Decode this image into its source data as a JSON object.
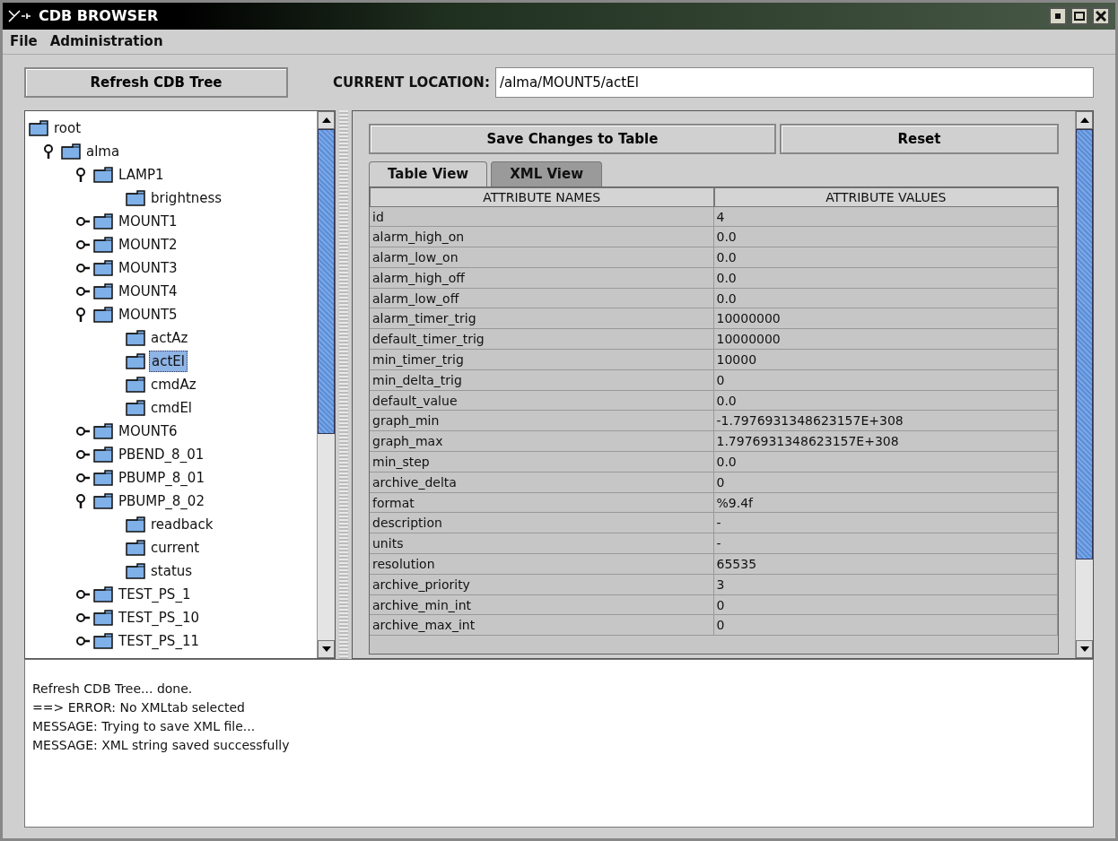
{
  "window": {
    "title": "CDB BROWSER"
  },
  "menu": [
    "File",
    "Administration"
  ],
  "refresh_button": "Refresh CDB Tree",
  "location": {
    "label": "CURRENT LOCATION:",
    "value": "/alma/MOUNT5/actEl"
  },
  "tree": [
    {
      "label": "root",
      "selected": false,
      "children": [
        {
          "label": "alma",
          "selected": false,
          "expanded": true,
          "children": [
            {
              "label": "LAMP1",
              "selected": false,
              "expanded": true,
              "children": [
                {
                  "label": "brightness",
                  "selected": false
                }
              ]
            },
            {
              "label": "MOUNT1",
              "selected": false,
              "expanded": false
            },
            {
              "label": "MOUNT2",
              "selected": false,
              "expanded": false
            },
            {
              "label": "MOUNT3",
              "selected": false,
              "expanded": false
            },
            {
              "label": "MOUNT4",
              "selected": false,
              "expanded": false
            },
            {
              "label": "MOUNT5",
              "selected": false,
              "expanded": true,
              "children": [
                {
                  "label": "actAz",
                  "selected": false
                },
                {
                  "label": "actEl",
                  "selected": true
                },
                {
                  "label": "cmdAz",
                  "selected": false
                },
                {
                  "label": "cmdEl",
                  "selected": false
                }
              ]
            },
            {
              "label": "MOUNT6",
              "selected": false,
              "expanded": false
            },
            {
              "label": "PBEND_8_01",
              "selected": false,
              "expanded": false
            },
            {
              "label": "PBUMP_8_01",
              "selected": false,
              "expanded": false
            },
            {
              "label": "PBUMP_8_02",
              "selected": false,
              "expanded": true,
              "children": [
                {
                  "label": "readback",
                  "selected": false
                },
                {
                  "label": "current",
                  "selected": false
                },
                {
                  "label": "status",
                  "selected": false
                }
              ]
            },
            {
              "label": "TEST_PS_1",
              "selected": false,
              "expanded": false
            },
            {
              "label": "TEST_PS_10",
              "selected": false,
              "expanded": false
            },
            {
              "label": "TEST_PS_11",
              "selected": false,
              "expanded": false
            }
          ]
        }
      ]
    }
  ],
  "actions": [
    "Save Changes to Table",
    "Reset"
  ],
  "tabs": [
    {
      "label": "Table View",
      "selected": true
    },
    {
      "label": "XML View",
      "selected": false
    }
  ],
  "table": {
    "columns": [
      "ATTRIBUTE NAMES",
      "ATTRIBUTE VALUES"
    ],
    "rows": [
      [
        "id",
        "4"
      ],
      [
        "alarm_high_on",
        "0.0"
      ],
      [
        "alarm_low_on",
        "0.0"
      ],
      [
        "alarm_high_off",
        "0.0"
      ],
      [
        "alarm_low_off",
        "0.0"
      ],
      [
        "alarm_timer_trig",
        "10000000"
      ],
      [
        "default_timer_trig",
        "10000000"
      ],
      [
        "min_timer_trig",
        "10000"
      ],
      [
        "min_delta_trig",
        "0"
      ],
      [
        "default_value",
        "0.0"
      ],
      [
        "graph_min",
        "-1.7976931348623157E+308"
      ],
      [
        "graph_max",
        "1.7976931348623157E+308"
      ],
      [
        "min_step",
        "0.0"
      ],
      [
        "archive_delta",
        "0"
      ],
      [
        "format",
        "%9.4f"
      ],
      [
        "description",
        "-"
      ],
      [
        "units",
        "-"
      ],
      [
        "resolution",
        "65535"
      ],
      [
        "archive_priority",
        "3"
      ],
      [
        "archive_min_int",
        "0"
      ],
      [
        "archive_max_int",
        "0"
      ]
    ]
  },
  "log": [
    "Refresh CDB Tree... done.",
    "==> ERROR: No XMLtab selected",
    "MESSAGE: Trying to save XML file...",
    "MESSAGE: XML string saved successfully"
  ]
}
